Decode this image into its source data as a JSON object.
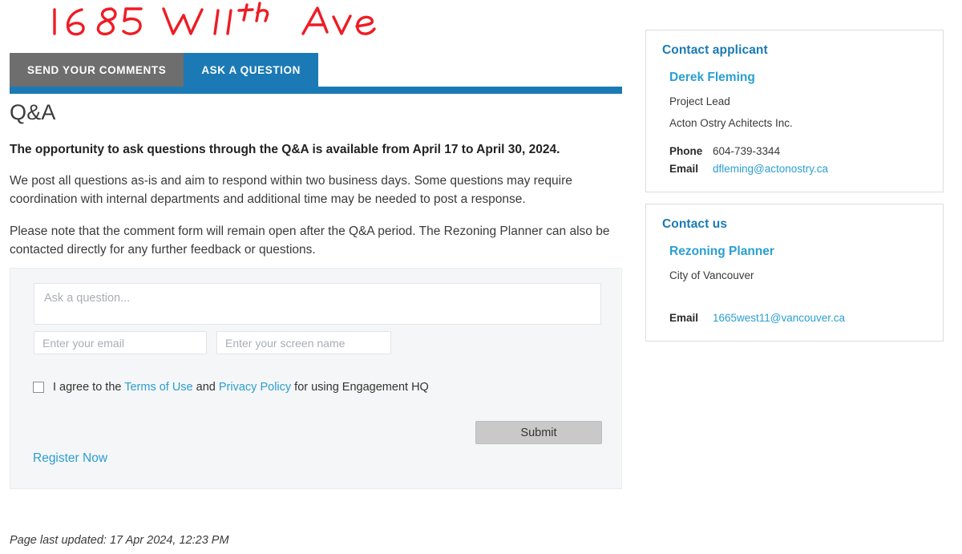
{
  "annotation": {
    "text": "1685 W 11th Ave",
    "color": "#ee1c25",
    "style": "handwritten-red-marker"
  },
  "tabs": [
    {
      "label": "SEND YOUR COMMENTS",
      "active": false
    },
    {
      "label": "ASK A QUESTION",
      "active": true
    }
  ],
  "accent_colors": {
    "tab_active": "#1b7ab5",
    "tab_inactive": "#6e6e6e",
    "link": "#2a9fd0",
    "heading_link": "#1b7ab5",
    "annotation_red": "#ee1c25"
  },
  "main": {
    "title": "Q&A",
    "lead": "The opportunity to ask questions through the Q&A is available from April 17 to April 30, 2024.",
    "paragraphs": [
      "We post all questions as-is and aim to respond within two business days. Some questions may require coordination with internal departments and additional time may be needed to post a response.",
      "Please note that the comment form will remain open after the Q&A period. The Rezoning Planner can also be contacted directly for any further feedback or questions."
    ]
  },
  "form": {
    "question_placeholder": "Ask a question...",
    "question_value": "",
    "email_placeholder": "Enter your email",
    "email_value": "",
    "screen_name_placeholder": "Enter your screen name",
    "screen_name_value": "",
    "agree": {
      "prefix": "I agree to the ",
      "terms_label": "Terms of Use",
      "middle": " and ",
      "privacy_label": "Privacy Policy",
      "suffix": " for using Engagement HQ",
      "checked": false
    },
    "submit_label": "Submit",
    "register_label": "Register Now"
  },
  "footer": {
    "last_updated": "Page last updated: 17 Apr 2024, 12:23 PM"
  },
  "rail": {
    "cards": [
      {
        "title": "Contact applicant",
        "name": "Derek Fleming",
        "role": "Project Lead",
        "org": "Acton Ostry Achitects Inc.",
        "phone_label": "Phone",
        "phone_value": "604-739-3344",
        "email_label": "Email",
        "email_value": "dfleming@actonostry.ca"
      },
      {
        "title": "Contact us",
        "name": "Rezoning Planner",
        "role": "City of Vancouver",
        "email_label": "Email",
        "email_value": "1665west11@vancouver.ca"
      }
    ]
  }
}
